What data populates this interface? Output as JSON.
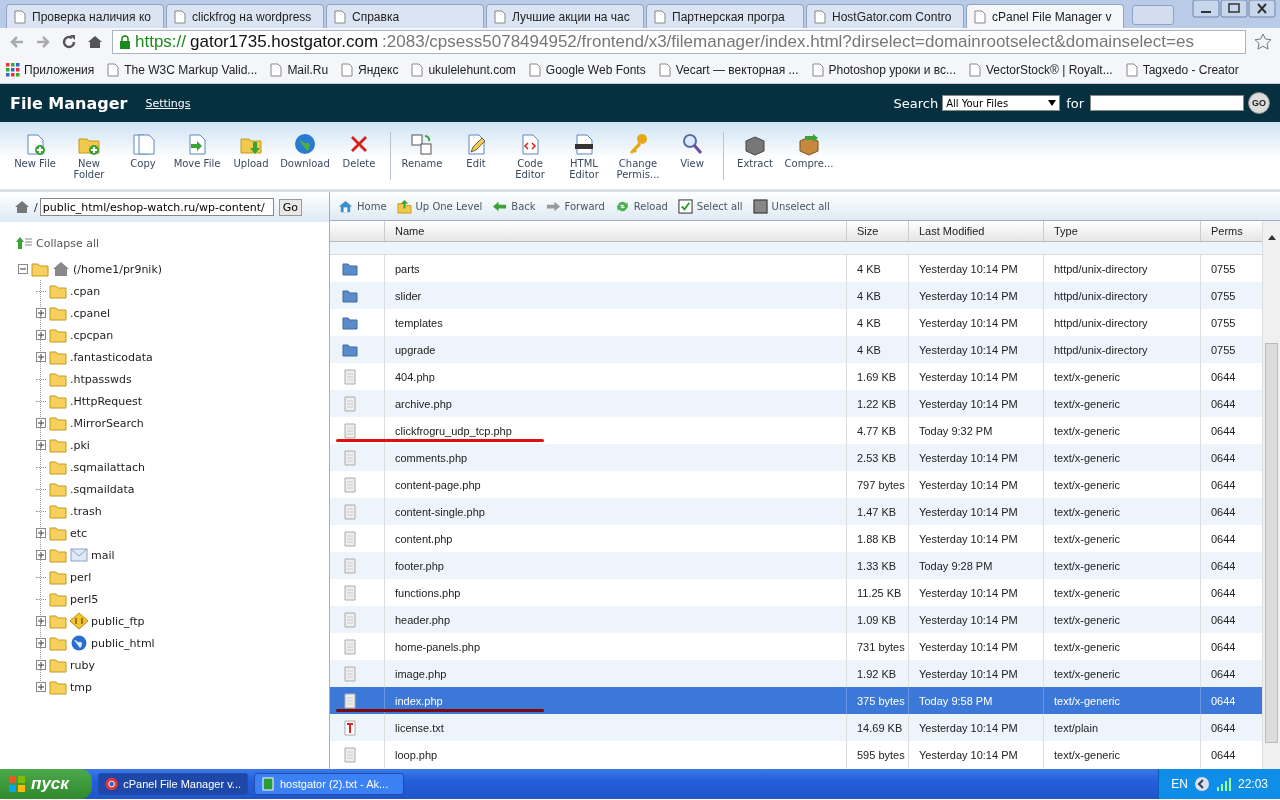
{
  "browser": {
    "tabs": [
      {
        "title": "Проверка наличия ко",
        "selected": false
      },
      {
        "title": "clickfrog на wordpress",
        "selected": false
      },
      {
        "title": "Справка",
        "selected": false
      },
      {
        "title": "Лучшие акции на час",
        "selected": false
      },
      {
        "title": "Партнерская програ",
        "selected": false
      },
      {
        "title": "HostGator.com Contro",
        "selected": false
      },
      {
        "title": "cPanel File Manager v",
        "selected": true
      }
    ],
    "url": {
      "scheme": "https://",
      "host": "gator1735.hostgator.com",
      "rest": ":2083/cpsess5078494952/frontend/x3/filemanager/index.html?dirselect=domainrootselect&domainselect=es"
    },
    "bookmarks": [
      "Приложения",
      "The W3C Markup Valid...",
      "Mail.Ru",
      "Яндекс",
      "ukulelehunt.com",
      "Google Web Fonts",
      "Vecart — векторная ...",
      "Photoshop уроки и вс...",
      "VectorStock® | Royalt...",
      "Tagxedo - Creator"
    ]
  },
  "header": {
    "title": "File Manager",
    "settings_link": "Settings",
    "search_label": "Search",
    "search_scope": "All Your Files",
    "for_label": "for",
    "go_button": "GO"
  },
  "toolbar": [
    {
      "label": "New File",
      "kind": "new-file",
      "separator_before": false
    },
    {
      "label": "New\nFolder",
      "kind": "new-folder",
      "separator_before": false
    },
    {
      "label": "Copy",
      "kind": "copy",
      "separator_before": false
    },
    {
      "label": "Move File",
      "kind": "move",
      "separator_before": false
    },
    {
      "label": "Upload",
      "kind": "upload",
      "separator_before": false
    },
    {
      "label": "Download",
      "kind": "download",
      "separator_before": false
    },
    {
      "label": "Delete",
      "kind": "delete",
      "separator_before": false
    },
    {
      "label": "Rename",
      "kind": "rename",
      "separator_before": true
    },
    {
      "label": "Edit",
      "kind": "edit",
      "separator_before": false
    },
    {
      "label": "Code\nEditor",
      "kind": "code",
      "separator_before": false
    },
    {
      "label": "HTML\nEditor",
      "kind": "html",
      "separator_before": false
    },
    {
      "label": "Change\nPermis...",
      "kind": "permissions",
      "separator_before": false
    },
    {
      "label": "View",
      "kind": "view",
      "separator_before": false
    },
    {
      "label": "Extract",
      "kind": "extract",
      "separator_before": true
    },
    {
      "label": "Compre...",
      "kind": "compress",
      "separator_before": false
    }
  ],
  "path_bar": {
    "prefix": "/",
    "value": "public_html/eshop-watch.ru/wp-content/",
    "go_button": "Go"
  },
  "tree": {
    "collapse_all": "Collapse all",
    "root": {
      "label": "(/home1/pr9nik)",
      "expanded": true,
      "children": [
        {
          "label": ".cpan",
          "expandable": false,
          "kind": "folder"
        },
        {
          "label": ".cpanel",
          "expandable": true,
          "kind": "folder"
        },
        {
          "label": ".cpcpan",
          "expandable": true,
          "kind": "folder"
        },
        {
          "label": ".fantasticodata",
          "expandable": true,
          "kind": "folder"
        },
        {
          "label": ".htpasswds",
          "expandable": false,
          "kind": "folder"
        },
        {
          "label": ".HttpRequest",
          "expandable": false,
          "kind": "folder"
        },
        {
          "label": ".MirrorSearch",
          "expandable": true,
          "kind": "folder"
        },
        {
          "label": ".pki",
          "expandable": true,
          "kind": "folder"
        },
        {
          "label": ".sqmailattach",
          "expandable": false,
          "kind": "folder"
        },
        {
          "label": ".sqmaildata",
          "expandable": false,
          "kind": "folder"
        },
        {
          "label": ".trash",
          "expandable": false,
          "kind": "folder"
        },
        {
          "label": "etc",
          "expandable": true,
          "kind": "folder"
        },
        {
          "label": "mail",
          "expandable": true,
          "kind": "mail"
        },
        {
          "label": "perl",
          "expandable": false,
          "kind": "folder"
        },
        {
          "label": "perl5",
          "expandable": false,
          "kind": "folder"
        },
        {
          "label": "public_ftp",
          "expandable": true,
          "kind": "ftp"
        },
        {
          "label": "public_html",
          "expandable": true,
          "kind": "web"
        },
        {
          "label": "ruby",
          "expandable": true,
          "kind": "folder"
        },
        {
          "label": "tmp",
          "expandable": true,
          "kind": "folder"
        }
      ]
    }
  },
  "nav": [
    {
      "label": "Home",
      "kind": "home"
    },
    {
      "label": "Up One Level",
      "kind": "up"
    },
    {
      "label": "Back",
      "kind": "back"
    },
    {
      "label": "Forward",
      "kind": "forward"
    },
    {
      "label": "Reload",
      "kind": "reload"
    },
    {
      "label": "Select all",
      "kind": "select"
    },
    {
      "label": "Unselect all",
      "kind": "unselect"
    }
  ],
  "table": {
    "columns": [
      "Name",
      "Size",
      "Last Modified",
      "Type",
      "Perms"
    ],
    "rows": [
      {
        "kind": "folder",
        "name": "parts",
        "size": "4 KB",
        "modified": "Yesterday 10:14 PM",
        "type": "httpd/unix-directory",
        "perms": "0755",
        "selected": false,
        "marked": false
      },
      {
        "kind": "folder",
        "name": "slider",
        "size": "4 KB",
        "modified": "Yesterday 10:14 PM",
        "type": "httpd/unix-directory",
        "perms": "0755",
        "selected": false,
        "marked": false
      },
      {
        "kind": "folder",
        "name": "templates",
        "size": "4 KB",
        "modified": "Yesterday 10:14 PM",
        "type": "httpd/unix-directory",
        "perms": "0755",
        "selected": false,
        "marked": false
      },
      {
        "kind": "folder",
        "name": "upgrade",
        "size": "4 KB",
        "modified": "Yesterday 10:14 PM",
        "type": "httpd/unix-directory",
        "perms": "0755",
        "selected": false,
        "marked": false
      },
      {
        "kind": "file",
        "name": "404.php",
        "size": "1.69 KB",
        "modified": "Yesterday 10:14 PM",
        "type": "text/x-generic",
        "perms": "0644",
        "selected": false,
        "marked": false
      },
      {
        "kind": "file",
        "name": "archive.php",
        "size": "1.22 KB",
        "modified": "Yesterday 10:14 PM",
        "type": "text/x-generic",
        "perms": "0644",
        "selected": false,
        "marked": false
      },
      {
        "kind": "file",
        "name": "clickfrogru_udp_tcp.php",
        "size": "4.77 KB",
        "modified": "Today 9:32 PM",
        "type": "text/x-generic",
        "perms": "0644",
        "selected": false,
        "marked": true
      },
      {
        "kind": "file",
        "name": "comments.php",
        "size": "2.53 KB",
        "modified": "Yesterday 10:14 PM",
        "type": "text/x-generic",
        "perms": "0644",
        "selected": false,
        "marked": false
      },
      {
        "kind": "file",
        "name": "content-page.php",
        "size": "797 bytes",
        "modified": "Yesterday 10:14 PM",
        "type": "text/x-generic",
        "perms": "0644",
        "selected": false,
        "marked": false
      },
      {
        "kind": "file",
        "name": "content-single.php",
        "size": "1.47 KB",
        "modified": "Yesterday 10:14 PM",
        "type": "text/x-generic",
        "perms": "0644",
        "selected": false,
        "marked": false
      },
      {
        "kind": "file",
        "name": "content.php",
        "size": "1.88 KB",
        "modified": "Yesterday 10:14 PM",
        "type": "text/x-generic",
        "perms": "0644",
        "selected": false,
        "marked": false
      },
      {
        "kind": "file",
        "name": "footer.php",
        "size": "1.33 KB",
        "modified": "Today 9:28 PM",
        "type": "text/x-generic",
        "perms": "0644",
        "selected": false,
        "marked": false
      },
      {
        "kind": "file",
        "name": "functions.php",
        "size": "11.25 KB",
        "modified": "Yesterday 10:14 PM",
        "type": "text/x-generic",
        "perms": "0644",
        "selected": false,
        "marked": false
      },
      {
        "kind": "file",
        "name": "header.php",
        "size": "1.09 KB",
        "modified": "Yesterday 10:14 PM",
        "type": "text/x-generic",
        "perms": "0644",
        "selected": false,
        "marked": false
      },
      {
        "kind": "file",
        "name": "home-panels.php",
        "size": "731 bytes",
        "modified": "Yesterday 10:14 PM",
        "type": "text/x-generic",
        "perms": "0644",
        "selected": false,
        "marked": false
      },
      {
        "kind": "file",
        "name": "image.php",
        "size": "1.92 KB",
        "modified": "Yesterday 10:14 PM",
        "type": "text/x-generic",
        "perms": "0644",
        "selected": false,
        "marked": false
      },
      {
        "kind": "file",
        "name": "index.php",
        "size": "375 bytes",
        "modified": "Today 9:58 PM",
        "type": "text/x-generic",
        "perms": "0644",
        "selected": true,
        "marked": true
      },
      {
        "kind": "text",
        "name": "license.txt",
        "size": "14.69 KB",
        "modified": "Yesterday 10:14 PM",
        "type": "text/plain",
        "perms": "0644",
        "selected": false,
        "marked": false
      },
      {
        "kind": "file",
        "name": "loop.php",
        "size": "595 bytes",
        "modified": "Yesterday 10:14 PM",
        "type": "text/x-generic",
        "perms": "0644",
        "selected": false,
        "marked": false
      }
    ]
  },
  "taskbar": {
    "start": "пуск",
    "tasks": [
      {
        "title": "cPanel File Manager v...",
        "selected": true
      },
      {
        "title": "hostgator (2).txt - Ak...",
        "selected": false
      }
    ],
    "language": "EN",
    "time": "22:03"
  }
}
